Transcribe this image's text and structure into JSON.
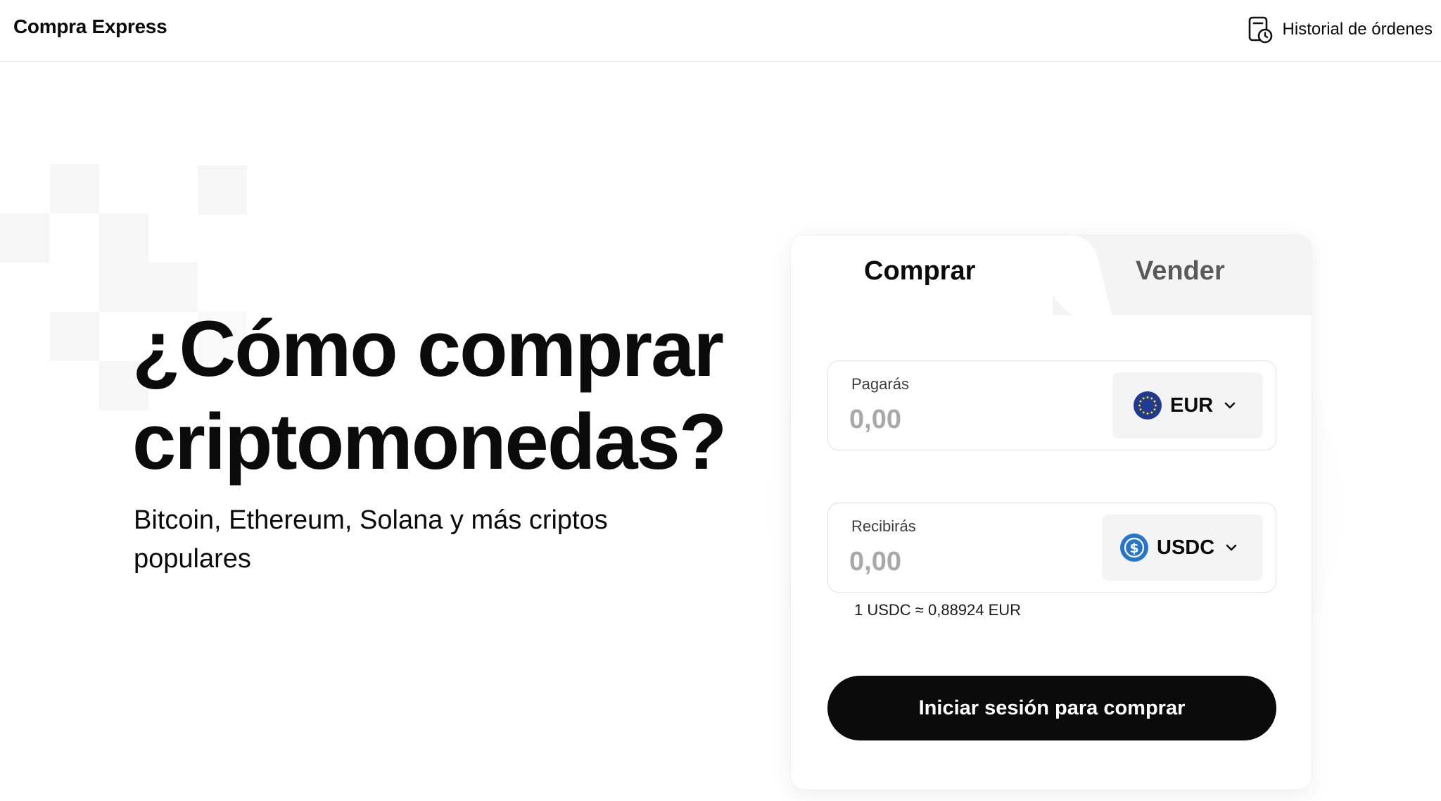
{
  "header": {
    "brand": "Compra Express",
    "history_label": "Historial de órdenes",
    "history_icon": "order-history-icon"
  },
  "hero": {
    "title_line1": "¿Cómo comprar",
    "title_line2": "criptomonedas?",
    "subtitle_line1": "Bitcoin, Ethereum, Solana y más criptos",
    "subtitle_line2": "populares"
  },
  "widget": {
    "tabs": [
      {
        "label": "Comprar",
        "active": true
      },
      {
        "label": "Vender",
        "active": false
      }
    ],
    "pay": {
      "label": "Pagarás",
      "placeholder": "0,00",
      "currency": "EUR",
      "currency_icon": "eur-flag-icon"
    },
    "receive": {
      "label": "Recibirás",
      "placeholder": "0,00",
      "currency": "USDC",
      "currency_icon": "usdc-icon"
    },
    "rate": "1 USDC ≈ 0,88924 EUR",
    "cta": "Iniciar sesión para comprar"
  },
  "colors": {
    "primary": "#0b0b0b",
    "muted": "#a9a9a9",
    "eur_blue": "#1f3a93",
    "usdc_blue": "#2775ca",
    "panel_gray": "#f4f4f4"
  }
}
